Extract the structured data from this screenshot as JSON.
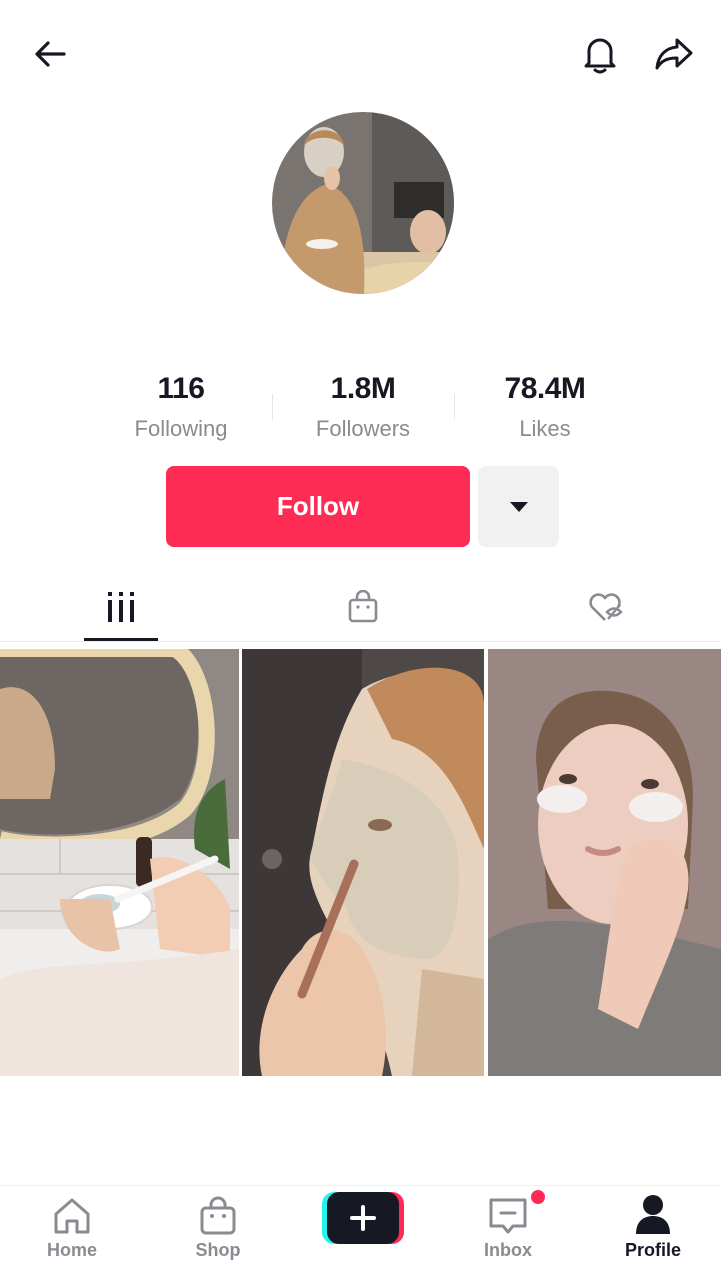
{
  "header": {
    "back_icon": "arrow-left-icon",
    "bell_icon": "bell-icon",
    "share_icon": "share-arrow-icon"
  },
  "profile": {
    "stats": [
      {
        "value": "116",
        "label": "Following"
      },
      {
        "value": "1.8M",
        "label": "Followers"
      },
      {
        "value": "78.4M",
        "label": "Likes"
      }
    ],
    "follow_label": "Follow",
    "accent_color": "#fe2c55"
  },
  "tabs": [
    {
      "icon": "videos-grid-icon",
      "active": true
    },
    {
      "icon": "shopping-bag-icon",
      "active": false
    },
    {
      "icon": "liked-hidden-icon",
      "active": false
    }
  ],
  "videos": [
    {
      "thumb": "woman-mixing-face-mask-at-mirror"
    },
    {
      "thumb": "woman-applying-clay-mask-profile"
    },
    {
      "thumb": "woman-with-under-eye-patches"
    }
  ],
  "bottom_nav": {
    "home": "Home",
    "shop": "Shop",
    "inbox": "Inbox",
    "profile": "Profile"
  }
}
